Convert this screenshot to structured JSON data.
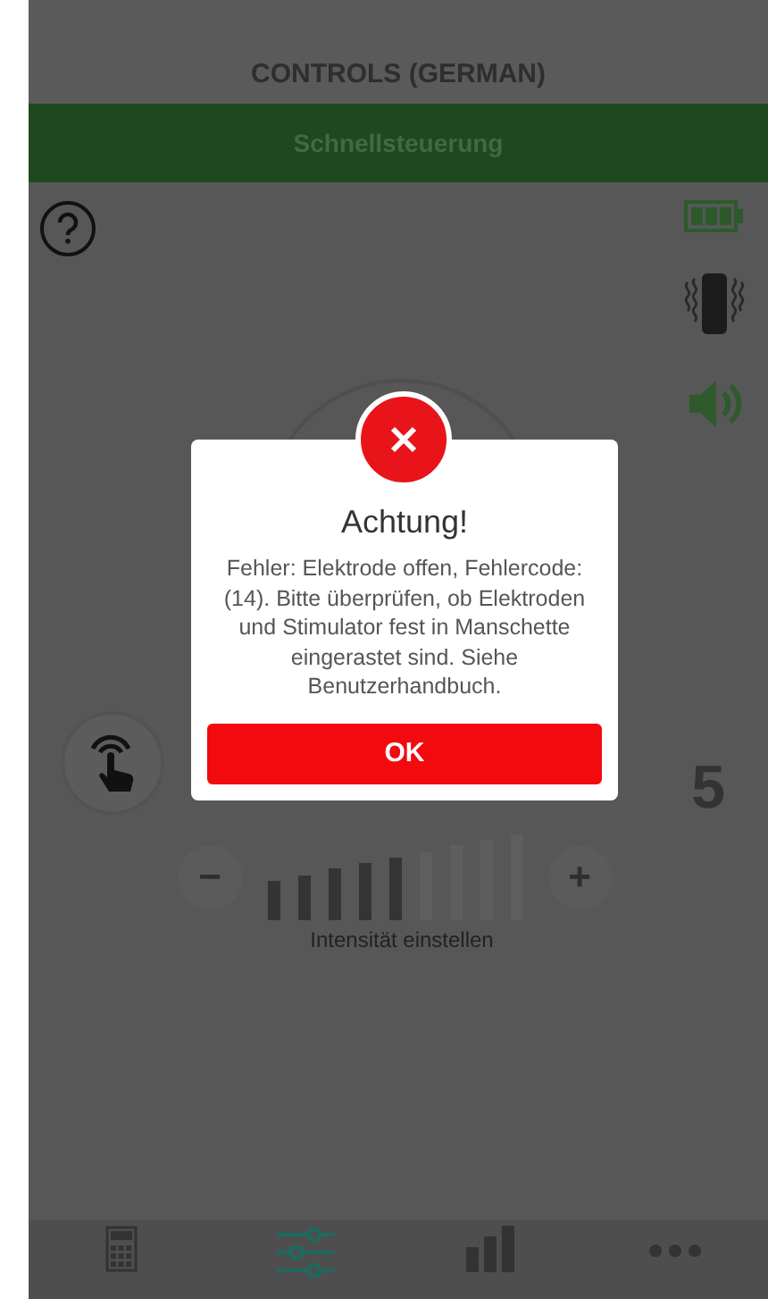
{
  "header": {
    "title": "CONTROLS (GERMAN)"
  },
  "mode_bar": {
    "label": "Schnellsteuerung"
  },
  "intensity": {
    "value": "5",
    "level": 0.5556,
    "minus": "−",
    "plus": "+",
    "label": "Intensität einstellen"
  },
  "tabs": [
    {
      "kind": "calculator",
      "selected": false
    },
    {
      "kind": "sliders",
      "selected": true
    },
    {
      "kind": "bars",
      "selected": false
    },
    {
      "kind": "dots",
      "selected": false
    }
  ],
  "dialog": {
    "title": "Achtung!",
    "message": "Fehler: Elektrode offen, Fehlercode:  (14). Bitte überprüfen, ob Elektroden und Stimulator fest in Manschette eingerastet sind. Siehe Benutzerhandbuch.",
    "button": "OK"
  }
}
